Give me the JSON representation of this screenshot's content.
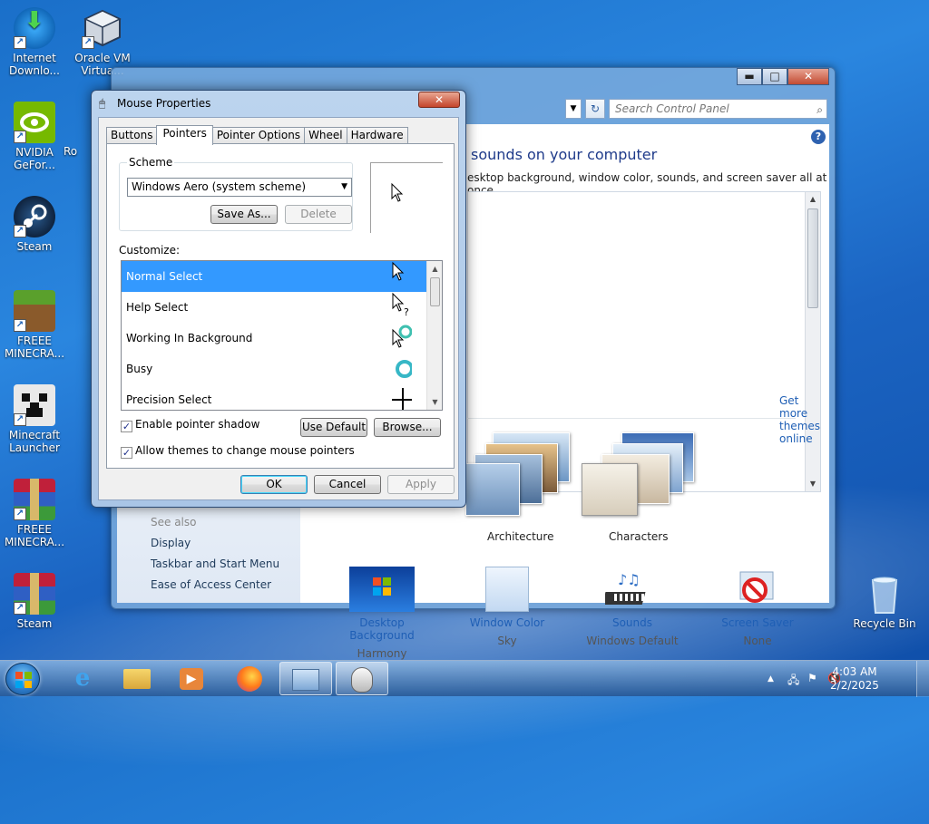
{
  "desktop": {
    "icons": [
      {
        "label": "Internet Downlo...",
        "icon": "download-manager-icon"
      },
      {
        "label": "Oracle VM Virtua...",
        "icon": "virtualbox-icon"
      },
      {
        "label": "NVIDIA GeFor...",
        "icon": "nvidia-icon"
      },
      {
        "label": "Ro",
        "icon": "partial-icon"
      },
      {
        "label": "Steam",
        "icon": "steam-icon"
      },
      {
        "label": "FREEE MINECRA...",
        "icon": "minecraft-icon"
      },
      {
        "label": "Minecraft Launcher",
        "icon": "minecraft-launcher-icon"
      },
      {
        "label": "FREEE MINECRA...",
        "icon": "winrar-icon"
      },
      {
        "label": "Steam",
        "icon": "winrar-icon"
      },
      {
        "label": "Recycle Bin",
        "icon": "recycle-bin-icon"
      }
    ]
  },
  "control_panel": {
    "search_placeholder": "Search Control Panel",
    "heading": "sounds on your computer",
    "subheading": "esktop background, window color, sounds, and screen saver all at once.",
    "get_more_themes": "Get more themes online",
    "themes": [
      {
        "label": "Architecture"
      },
      {
        "label": "Characters"
      }
    ],
    "see_also": "See also",
    "links": [
      "Display",
      "Taskbar and Start Menu",
      "Ease of Access Center"
    ],
    "bottom_items": [
      {
        "label": "Desktop Background",
        "sub": "Harmony",
        "icon": "desktop-background-icon"
      },
      {
        "label": "Window Color",
        "sub": "Sky",
        "icon": "window-color-icon"
      },
      {
        "label": "Sounds",
        "sub": "Windows Default",
        "icon": "sounds-icon"
      },
      {
        "label": "Screen Saver",
        "sub": "None",
        "icon": "screen-saver-icon"
      }
    ]
  },
  "mouse_dialog": {
    "title": "Mouse Properties",
    "close": "✕",
    "tabs": [
      "Buttons",
      "Pointers",
      "Pointer Options",
      "Wheel",
      "Hardware"
    ],
    "active_tab": "Pointers",
    "scheme_label": "Scheme",
    "scheme_value": "Windows Aero (system scheme)",
    "save_as": "Save As...",
    "delete": "Delete",
    "customize_label": "Customize:",
    "cursors": [
      {
        "name": "Normal Select",
        "icon": "arrow-cursor-icon",
        "selected": true
      },
      {
        "name": "Help Select",
        "icon": "help-cursor-icon",
        "selected": false
      },
      {
        "name": "Working In Background",
        "icon": "working-cursor-icon",
        "selected": false
      },
      {
        "name": "Busy",
        "icon": "busy-cursor-icon",
        "selected": false
      },
      {
        "name": "Precision Select",
        "icon": "crosshair-cursor-icon",
        "selected": false
      }
    ],
    "enable_shadow": "Enable pointer shadow",
    "enable_shadow_checked": true,
    "allow_themes": "Allow themes to change mouse pointers",
    "allow_themes_checked": true,
    "use_default": "Use Default",
    "browse": "Browse...",
    "ok": "OK",
    "cancel": "Cancel",
    "apply": "Apply"
  },
  "taskbar": {
    "time": "4:03 AM",
    "date": "2/2/2025",
    "apps": [
      {
        "icon": "internet-explorer-icon",
        "active": false
      },
      {
        "icon": "file-explorer-icon",
        "active": false
      },
      {
        "icon": "media-player-icon",
        "active": false
      },
      {
        "icon": "firefox-icon",
        "active": false
      },
      {
        "icon": "control-panel-icon",
        "active": true
      },
      {
        "icon": "mouse-icon",
        "active": true
      }
    ]
  }
}
